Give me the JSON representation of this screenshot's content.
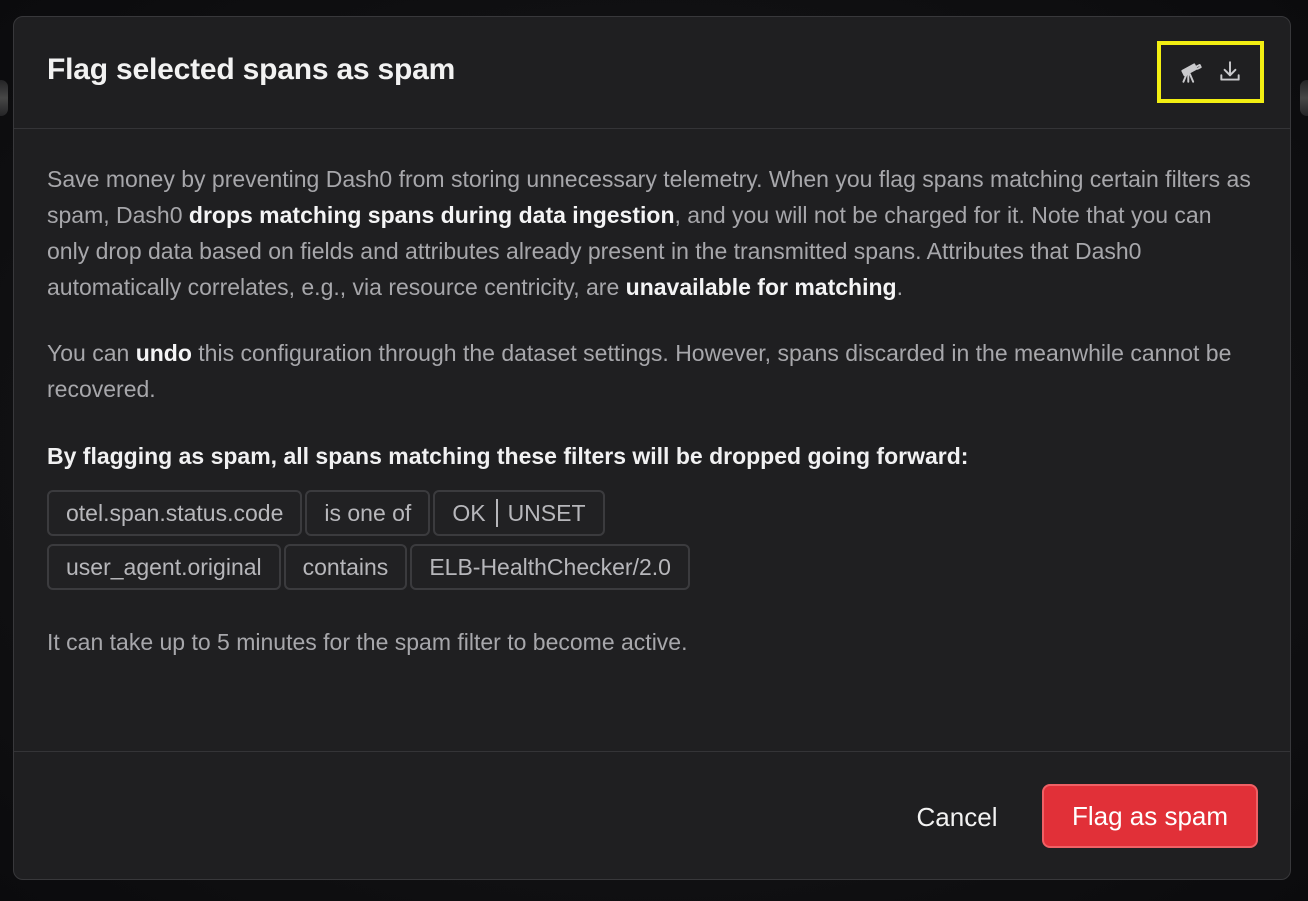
{
  "dialog": {
    "title": "Flag selected spans as spam",
    "header_icons": [
      "telescope-icon",
      "download-icon"
    ]
  },
  "body": {
    "p1": [
      "Save money by preventing Dash0 from storing unnecessary telemetry. When you flag spans matching certain filters as spam, Dash0 ",
      "drops matching spans during data ingestion",
      ", and you will not be charged for it. Note that you can only drop data based on fields and attributes already present in the transmitted spans. Attributes that Dash0 automatically correlates, e.g., via resource centricity, are ",
      "unavailable for matching",
      "."
    ],
    "p2": [
      "You can ",
      "undo",
      " this configuration through the dataset settings. However, spans discarded in the meanwhile cannot be recovered."
    ],
    "lead": "By flagging as spam, all spans matching these filters will be dropped going forward:",
    "filters": [
      {
        "field": "otel.span.status.code",
        "operator": "is one of",
        "values": [
          "OK",
          "UNSET"
        ]
      },
      {
        "field": "user_agent.original",
        "operator": "contains",
        "value": "ELB-HealthChecker/2.0"
      }
    ],
    "note": "It can take up to 5 minutes for the spam filter to become active."
  },
  "footer": {
    "cancel_label": "Cancel",
    "confirm_label": "Flag as spam"
  },
  "colors": {
    "primary": "#e13038",
    "highlight": "#f2ee12",
    "surface": "#1f1f21"
  }
}
